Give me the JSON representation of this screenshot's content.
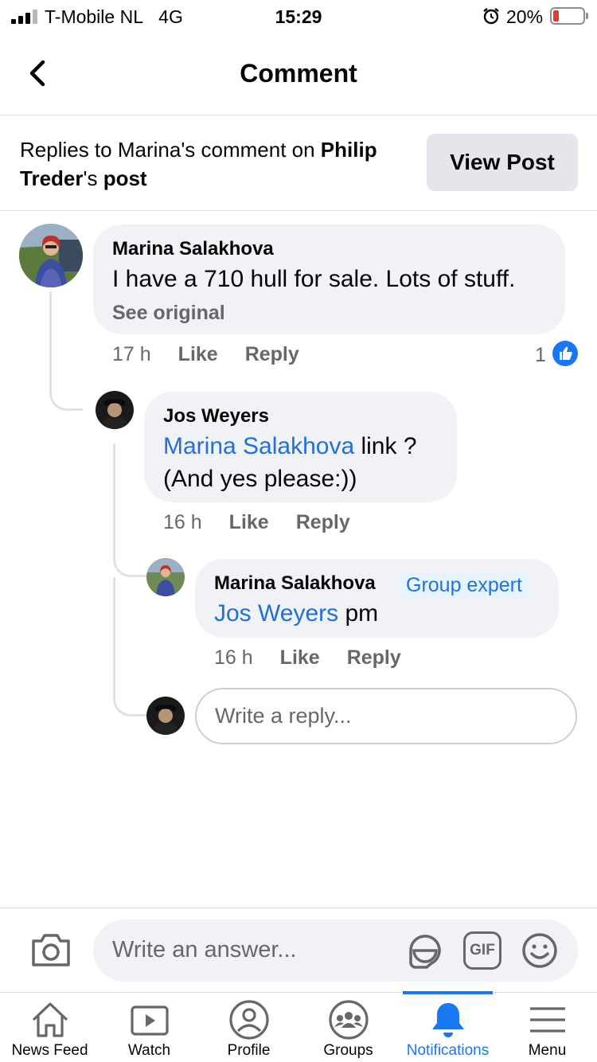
{
  "status_bar": {
    "carrier": "T-Mobile NL",
    "network": "4G",
    "time": "15:29",
    "battery_percent": "20%"
  },
  "header": {
    "title": "Comment",
    "back_icon": "chevron-left-icon"
  },
  "context": {
    "prefix": "Replies to Marina's comment on ",
    "post_author_first": "Philip",
    "post_author_last": "Treder",
    "suffix_possessive": "'s ",
    "post_word": "post",
    "view_post_label": "View Post"
  },
  "comments": [
    {
      "author": "Marina  Salakhova",
      "text": "I have a 710 hull for sale. Lots of stuff.",
      "see_original": "See original",
      "time": "17 h",
      "like_label": "Like",
      "reply_label": "Reply",
      "like_count": "1"
    },
    {
      "author": "Jos Weyers",
      "mention": "Marina  Salakhova",
      "text_after_mention": " link ?",
      "text_line2": "(And yes please:))",
      "time": "16 h",
      "like_label": "Like",
      "reply_label": "Reply"
    },
    {
      "author": "Marina  Salakhova",
      "badge": "Group expert",
      "mention": "Jos Weyers",
      "text_after_mention": " pm",
      "time": "16 h",
      "like_label": "Like",
      "reply_label": "Reply"
    }
  ],
  "reply_input": {
    "placeholder": "Write a reply..."
  },
  "composer": {
    "placeholder": "Write an answer...",
    "icons": [
      "camera-icon",
      "sticker-icon",
      "gif-icon",
      "emoji-icon"
    ],
    "gif_label": "GIF"
  },
  "tabs": [
    {
      "label": "News Feed",
      "icon": "home-icon"
    },
    {
      "label": "Watch",
      "icon": "watch-icon"
    },
    {
      "label": "Profile",
      "icon": "profile-icon"
    },
    {
      "label": "Groups",
      "icon": "groups-icon"
    },
    {
      "label": "Notifications",
      "icon": "bell-icon",
      "active": true
    },
    {
      "label": "Menu",
      "icon": "menu-icon"
    }
  ],
  "colors": {
    "accent": "#1877f2",
    "mention": "#216fdb",
    "bubble": "#f0f2f5",
    "muted": "#65676b"
  }
}
